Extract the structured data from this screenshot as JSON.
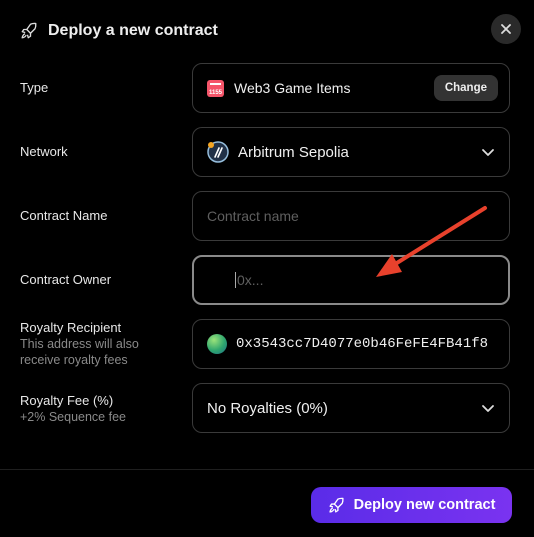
{
  "header": {
    "title": "Deploy a new contract",
    "icon": "rocket-icon"
  },
  "close": {
    "icon": "close-icon"
  },
  "type": {
    "label": "Type",
    "value": "Web3 Game Items",
    "badge_text": "1155",
    "change_label": "Change"
  },
  "network": {
    "label": "Network",
    "value": "Arbitrum Sepolia"
  },
  "contract_name": {
    "label": "Contract Name",
    "placeholder": "Contract name"
  },
  "contract_owner": {
    "label": "Contract Owner",
    "placeholder": "0x..."
  },
  "royalty_recipient": {
    "label": "Royalty Recipient",
    "sublabel": "This address will also receive royalty fees",
    "value": "0x3543cc7D4077e0b46FeFE4FB41f8"
  },
  "royalty_fee": {
    "label": "Royalty Fee (%)",
    "sublabel": "+2% Sequence fee",
    "value": "No Royalties (0%)"
  },
  "footer": {
    "deploy_label": "Deploy new contract"
  },
  "colors": {
    "accent": "#6a2ff0",
    "annotation_arrow": "#e8412c",
    "badge": "#f5556a"
  }
}
